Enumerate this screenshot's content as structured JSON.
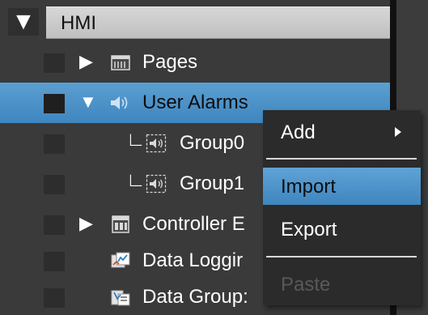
{
  "tree": {
    "root": {
      "label": "HMI",
      "toggle": "▼"
    },
    "items": [
      {
        "label": "Pages",
        "icon": "pages-icon",
        "arrow": "▶",
        "selected": false
      },
      {
        "label": "User Alarms",
        "icon": "speaker-icon",
        "arrow": "▼",
        "selected": true
      },
      {
        "label": "Group0",
        "icon": "speaker-group-icon",
        "branch": "∟",
        "selected": false
      },
      {
        "label": "Group1",
        "icon": "speaker-group-icon",
        "branch": "∟",
        "selected": false
      },
      {
        "label": "Controller E",
        "icon": "controller-icon",
        "arrow": "▶",
        "selected": false
      },
      {
        "label": "Data Loggir",
        "icon": "data-logging-icon",
        "selected": false
      },
      {
        "label": "Data Group:",
        "icon": "data-group-icon",
        "selected": false
      }
    ]
  },
  "context_menu": {
    "items": [
      {
        "label": "Add",
        "has_submenu": true,
        "state": "normal"
      },
      {
        "label": "Import",
        "has_submenu": false,
        "state": "highlighted"
      },
      {
        "label": "Export",
        "has_submenu": false,
        "state": "normal"
      },
      {
        "label": "Paste",
        "has_submenu": false,
        "state": "disabled"
      }
    ]
  },
  "colors": {
    "background": "#3a3a3a",
    "selection": "#4a90c8",
    "header_band": "#cccccc",
    "menu_background": "#2b2b2b",
    "disabled_text": "#595959"
  }
}
